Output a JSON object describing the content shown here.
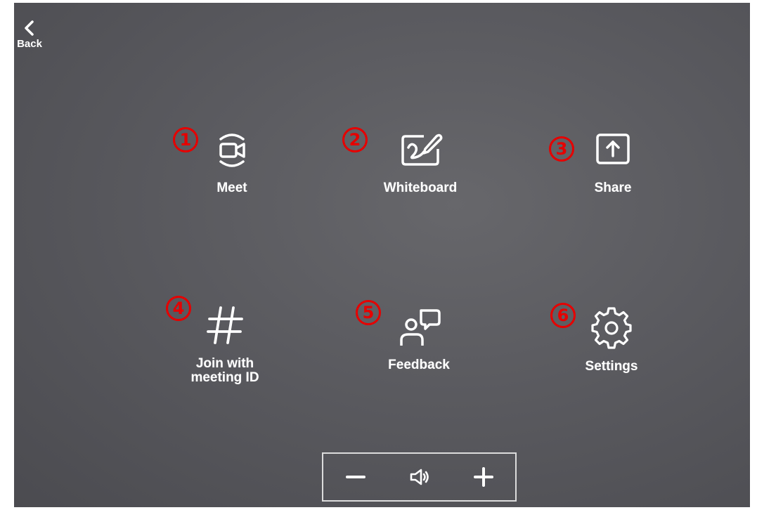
{
  "header": {
    "back_label": "Back"
  },
  "tiles": [
    {
      "number": "1",
      "label": "Meet",
      "icon": "video-camera-icon"
    },
    {
      "number": "2",
      "label": "Whiteboard",
      "icon": "whiteboard-icon"
    },
    {
      "number": "3",
      "label": "Share",
      "icon": "share-upload-icon"
    },
    {
      "number": "4",
      "label": "Join with\nmeeting ID",
      "icon": "hashtag-icon"
    },
    {
      "number": "5",
      "label": "Feedback",
      "icon": "feedback-icon"
    },
    {
      "number": "6",
      "label": "Settings",
      "icon": "gear-icon"
    }
  ],
  "volume_bar": {
    "decrease_icon": "minus-icon",
    "speaker_icon": "speaker-icon",
    "increase_icon": "plus-icon"
  },
  "colors": {
    "background": "#5a5a5f",
    "foreground": "#ffffff",
    "annotation": "#e60000"
  }
}
